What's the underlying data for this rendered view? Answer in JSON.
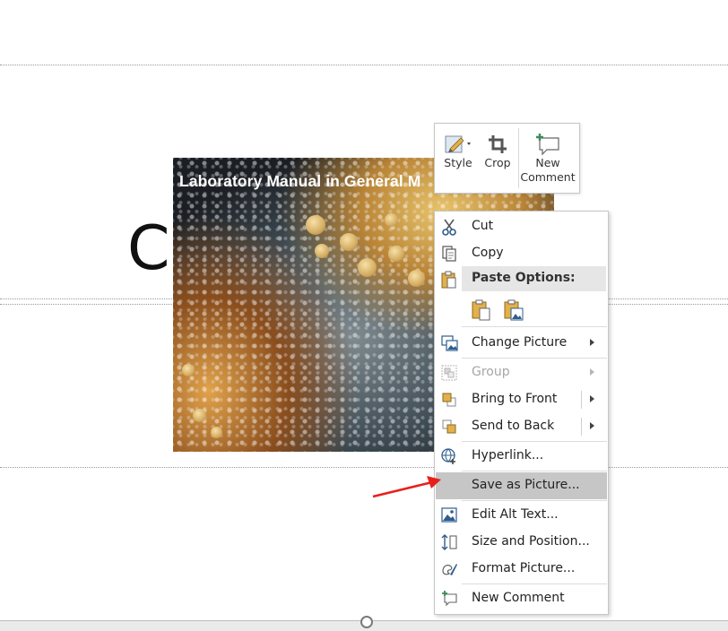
{
  "slide": {
    "title_fragment": "Cl",
    "picture_caption": "Laboratory Manual in General M"
  },
  "mini_toolbar": {
    "style_label": "Style",
    "crop_label": "Crop",
    "new_comment_line1": "New",
    "new_comment_line2": "Comment"
  },
  "context_menu": {
    "cut": "Cut",
    "copy": "Copy",
    "paste_options": "Paste Options:",
    "change_picture": "Change Picture",
    "group": "Group",
    "bring_to_front": "Bring to Front",
    "send_to_back": "Send to Back",
    "hyperlink": "Hyperlink...",
    "save_as_picture": "Save as Picture...",
    "edit_alt_text": "Edit Alt Text...",
    "size_and_position": "Size and Position...",
    "format_picture": "Format Picture...",
    "new_comment": "New Comment"
  },
  "colors": {
    "highlight": "#c6c6c6",
    "annotation_arrow": "#e8201b",
    "icon_blue": "#2e5d8e",
    "icon_green": "#3f8a5a",
    "paste_gold": "#e3b04b"
  },
  "icons": {
    "style": "style-brush-icon",
    "crop": "crop-icon",
    "new_comment": "new-comment-icon",
    "cut": "scissors-icon",
    "copy": "copy-icon",
    "paste": "clipboard-icon",
    "change_picture": "change-picture-icon",
    "group": "group-icon",
    "bring_to_front": "bring-to-front-icon",
    "send_to_back": "send-to-back-icon",
    "hyperlink": "hyperlink-globe-icon",
    "edit_alt_text": "alt-text-icon",
    "size_and_position": "size-position-icon",
    "format_picture": "format-picture-icon"
  }
}
